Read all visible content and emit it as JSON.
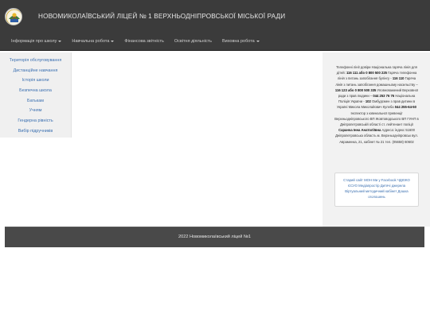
{
  "header": {
    "site_title": "НОВОМИКОЛАЇВСЬКИЙ ЛІЦЕЙ № 1 ВЕРХНЬОДНІПРОВСЬКОЇ МІСЬКОЇ РАДИ",
    "nav": [
      {
        "label": "Інформація про школу",
        "dropdown": true
      },
      {
        "label": "Навчальна робота",
        "dropdown": true
      },
      {
        "label": "Фінансова звітність",
        "dropdown": false
      },
      {
        "label": "Освітня діяльність",
        "dropdown": false
      },
      {
        "label": "Виховна робота",
        "dropdown": true
      }
    ]
  },
  "sidebar": {
    "items": [
      {
        "label": "Територія обслуговування"
      },
      {
        "label": "Дистанційне навчання"
      },
      {
        "label": "Історія школи"
      },
      {
        "label": "Безпечна школа"
      },
      {
        "label": "Батькам"
      },
      {
        "label": "Учням"
      },
      {
        "label": "Гендерна рівність"
      },
      {
        "label": "Вибір підручників"
      }
    ]
  },
  "right_panel": {
    "t1": "Телефонні лінії довіри Національна гаряча лінія для дітей:",
    "b1": "116 111 або 0 800 500 225",
    "t2": "Гаряча телефонна лінія з питань запобігання булінгу -",
    "b2": "116 110",
    "t3": "Гаряча лінія з питань запобігання домашньому насильству –",
    "b3": "116 123 або 0 800 500 335",
    "t4": "Уповноважений Верховної ради з прав людини –",
    "b4": "044 253 76 76",
    "t5": "Національна Поліція України -",
    "b5": "102",
    "t6": "Омбудсмен з прав дитини в Україні Микола Миколайович Кулеба",
    "b6": "044 255-64-50",
    "t7": "Інспектор з ювенальної превенції Верхньодніпровського ВП Жовтоводського ВП ГУНП в Дніпропетровській області ст. лейтенант поліції",
    "b7": "Саранча Інна Анатоліївна",
    "t8": "Адреса: індекс 51600 Дніпропетровська область м. Верхньодніпровськ вул. Авраменка, 21, кабінет № 21 тел. (05658) 60602",
    "links": [
      {
        "label": "Старий сайт"
      },
      {
        "label": "МОН"
      },
      {
        "label": "Ми у Facebook"
      },
      {
        "label": "ЧДЮКО"
      },
      {
        "label": "ЄСУО"
      },
      {
        "label": "Медіапростір"
      },
      {
        "label": "Дитячі джерела"
      },
      {
        "label": "Віртуальний методичний кабінет"
      },
      {
        "label": "Дошка оголошень"
      }
    ]
  },
  "footer": {
    "text": "2022 Новомиколаївський ліцей №1"
  }
}
